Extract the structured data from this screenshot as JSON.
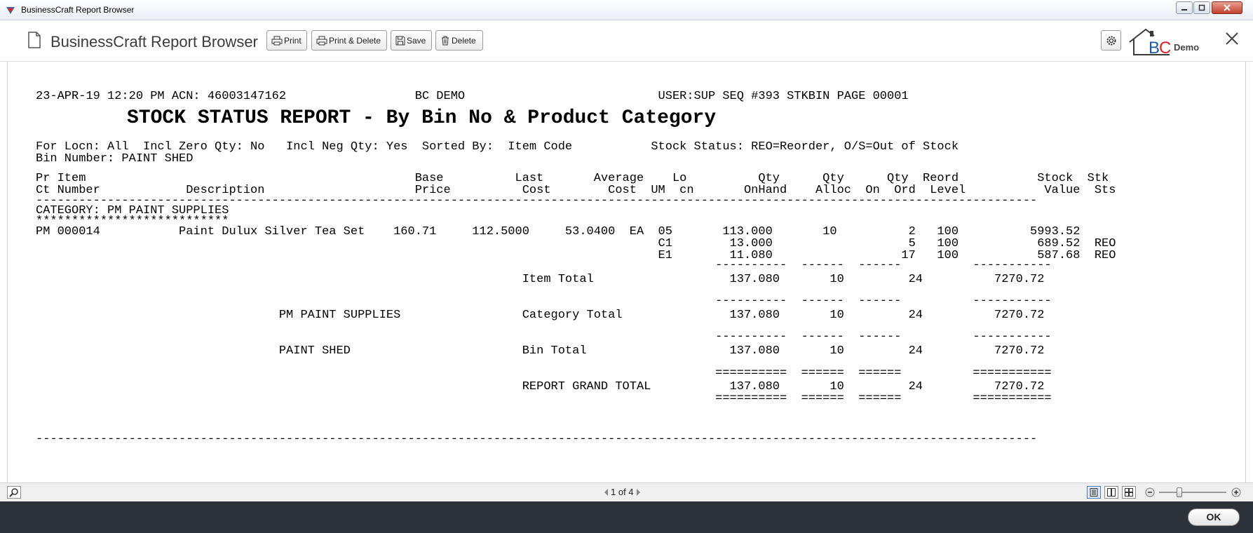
{
  "window": {
    "title": "BusinessCraft Report Browser"
  },
  "toolbar": {
    "app_title": "BusinessCraft Report Browser",
    "buttons": {
      "print": "Print",
      "print_delete": "Print & Delete",
      "save": "Save",
      "delete": "Delete"
    },
    "logo_letters": "BC",
    "company": "Demo"
  },
  "report": {
    "lines": [
      "23-APR-19 12:20 PM ACN: 46003147162                  BC DEMO                           USER:SUP SEQ #393 STKBIN PAGE 00001",
      "STOCK STATUS REPORT - By Bin No & Product Category",
      "For Locn: All  Incl Zero Qty: No   Incl Neg Qty: Yes  Sorted By:  Item Code           Stock Status: REO=Reorder, O/S=Out of Stock",
      "Bin Number: PAINT SHED",
      "Pr Item                                              Base          Last       Average    Lo          Qty      Qty      Qty  Reord           Stock  Stk",
      "Ct Number            Description                     Price          Cost        Cost  UM  cn       OnHand    Alloc  On  Ord  Level           Value  Sts",
      "--------------------------------------------------------------------------------------------------------------------------------------------",
      "CATEGORY: PM PAINT SUPPLIES",
      "***************************",
      "PM 000014           Paint Dulux Silver Tea Set    160.71     112.5000     53.0400  EA  05       113.000       10          2   100          5993.52",
      "                                                                                       C1        13.000                   5   100           689.52  REO",
      "                                                                                       E1        11.080                  17   100           587.68  REO",
      "                                                                                               ----------  ------  ------          -----------",
      "                                                                    Item Total                   137.080       10         24          7270.72",
      "                                                                                               ----------  ------  ------          -----------",
      "                                  PM PAINT SUPPLIES                 Category Total               137.080       10         24          7270.72",
      "                                                                                               ----------  ------  ------          -----------",
      "                                  PAINT SHED                        Bin Total                    137.080       10         24          7270.72",
      "                                                                                               ==========  ======  ======          ===========",
      "                                                                    REPORT GRAND TOTAL           137.080       10         24          7270.72",
      "                                                                                               ==========  ======  ======          ===========",
      "--------------------------------------------------------------------------------------------------------------------------------------------"
    ]
  },
  "statusbar": {
    "page_indicator": "1 of 4",
    "zoom_level": 0.3
  },
  "bottom": {
    "ok_label": "OK"
  },
  "colors": {
    "bottom_bar": "#2c3238",
    "close_red": "#c2412c",
    "logo_red": "#d9232e",
    "logo_blue": "#1c5aa8"
  }
}
